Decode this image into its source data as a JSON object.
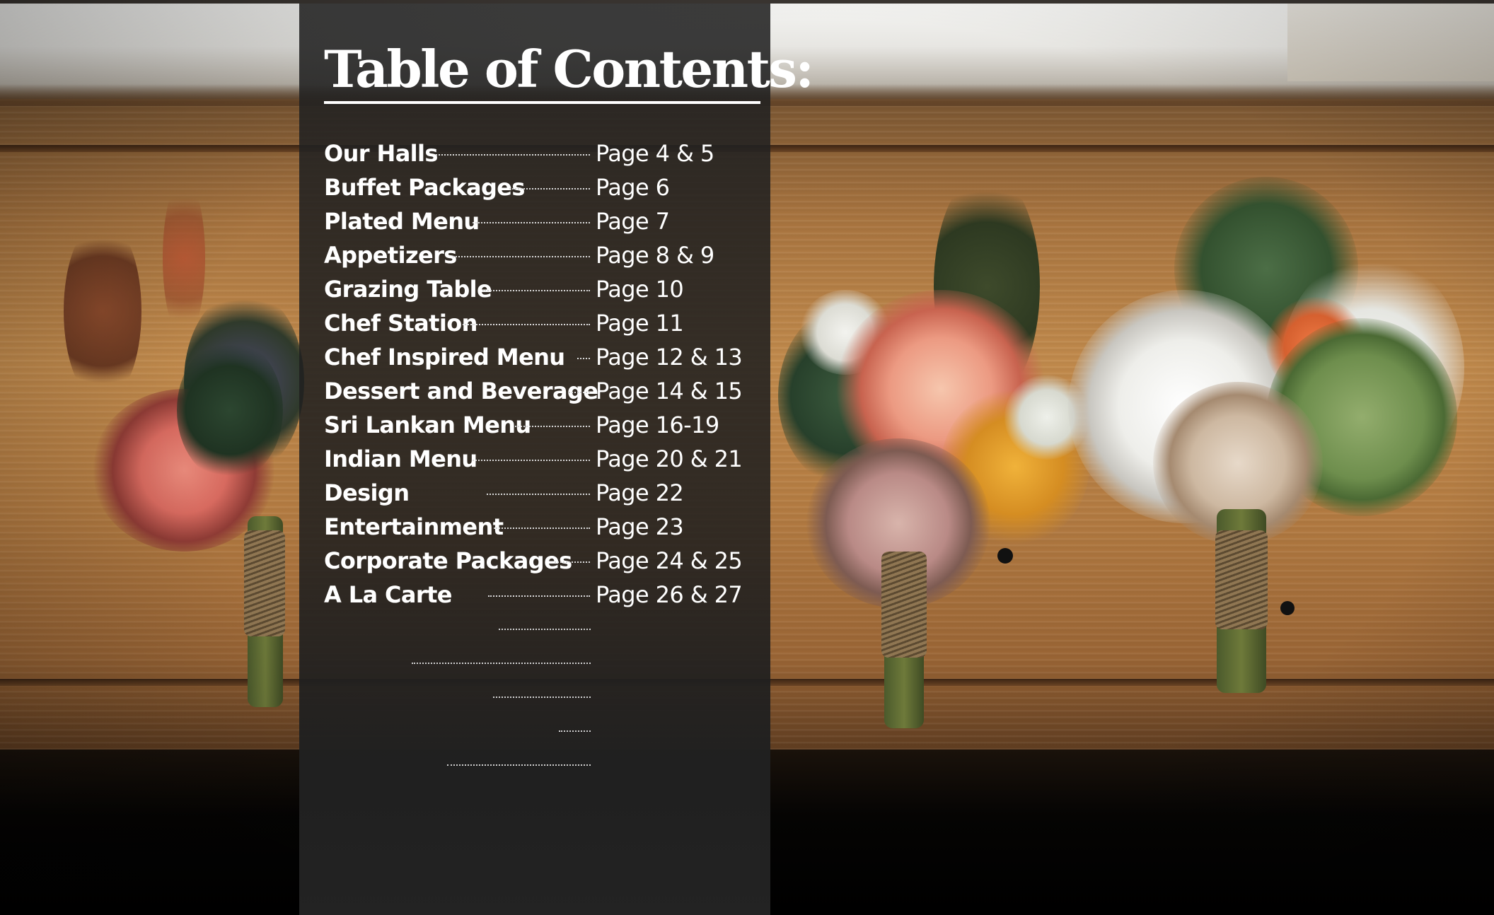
{
  "title": "Table of Contents:",
  "entries": [
    {
      "label": "Our Halls",
      "page": "Page 4 & 5"
    },
    {
      "label": "Buffet Packages",
      "page": "Page 6"
    },
    {
      "label": "Plated Menu",
      "page": "Page 7"
    },
    {
      "label": "Appetizers",
      "page": "Page 8 & 9"
    },
    {
      "label": "Grazing Table",
      "page": "Page 10"
    },
    {
      "label": "Chef Station",
      "page": "Page 11"
    },
    {
      "label": "Chef Inspired Menu",
      "page": "Page 12 & 13"
    },
    {
      "label": "Dessert and Beverage",
      "page": "Page 14 & 15"
    },
    {
      "label": "Sri Lankan Menu",
      "page": "Page 16-19"
    },
    {
      "label": "Indian Menu",
      "page": "Page 20 & 21"
    },
    {
      "label": "Design",
      "page": "Page 22"
    },
    {
      "label": "Entertainment",
      "page": "Page 23"
    },
    {
      "label": "Corporate Packages",
      "page": "Page 24 & 25"
    },
    {
      "label": "A La Carte",
      "page": "Page 26 & 27"
    }
  ],
  "colors": {
    "panel": "#222222",
    "text": "#ffffff",
    "wood": "#b47c42"
  },
  "background_image": "boutonnieres-on-wooden-table"
}
